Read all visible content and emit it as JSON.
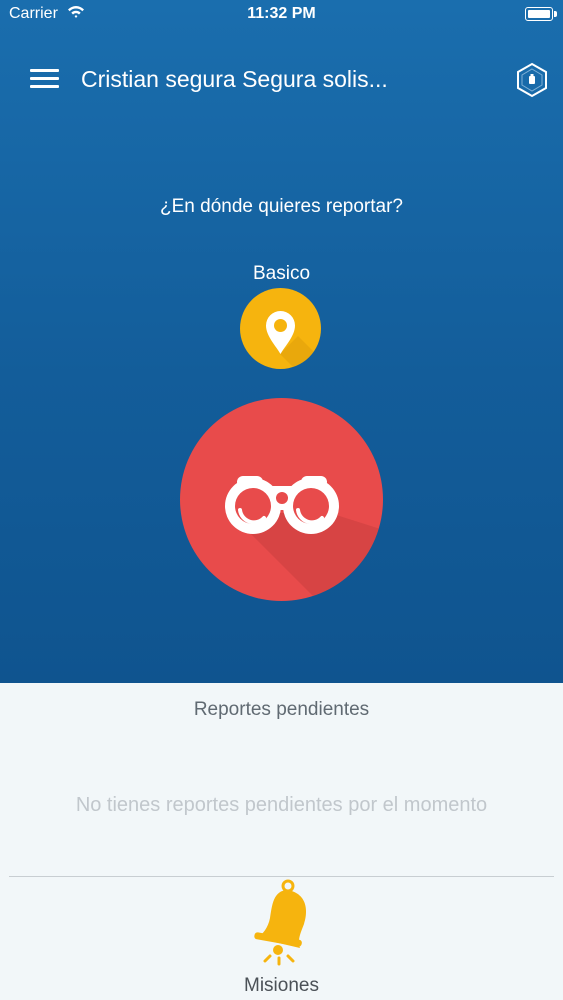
{
  "status_bar": {
    "carrier": "Carrier",
    "time": "11:32 PM",
    "icons": [
      "wifi-icon",
      "battery-icon"
    ]
  },
  "header": {
    "title": "Cristian segura  Segura solis...",
    "menu_icon": "hamburger-menu-icon",
    "right_icon": "hexagon-badge-icon"
  },
  "main": {
    "question": "¿En dónde quieres reportar?",
    "mode_label": "Basico",
    "location_icon": "map-pin-icon",
    "action_icon": "binoculars-icon"
  },
  "pending": {
    "title": "Reportes pendientes",
    "empty_message": "No tienes reportes pendientes por el momento"
  },
  "footer": {
    "missions_label": "Misiones",
    "missions_icon": "bell-icon"
  },
  "colors": {
    "top_gradient_start": "#1a6eae",
    "top_gradient_end": "#0f548f",
    "location_button": "#f6b40e",
    "observe_button": "#e84b4b",
    "bottom_background": "#f2f7f9",
    "bell": "#f6b40e"
  }
}
